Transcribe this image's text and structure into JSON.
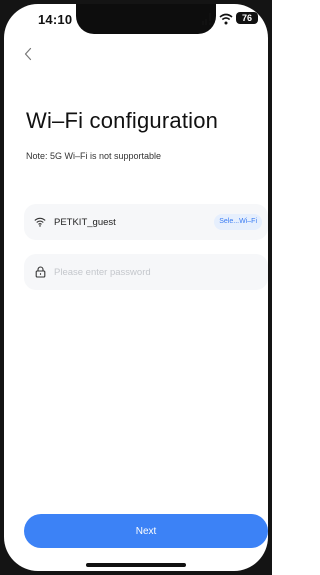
{
  "status_bar": {
    "time": "14:10",
    "battery": "76",
    "signal_icon": "signal-alert-icon",
    "wifi_icon": "wifi-icon"
  },
  "nav": {
    "back_icon": "chevron-left-icon"
  },
  "page": {
    "title": "Wi–Fi configuration",
    "note": "Note: 5G Wi–Fi is not supportable"
  },
  "wifi_field": {
    "icon": "wifi-icon",
    "ssid": "PETKIT_guest",
    "select_label": "Sele...Wi–Fi"
  },
  "password_field": {
    "icon": "lock-icon",
    "placeholder": "Please enter password",
    "value": ""
  },
  "actions": {
    "next_label": "Next"
  },
  "colors": {
    "accent": "#3c82f6",
    "field_bg": "#f6f7f9",
    "select_bg": "#e6effd",
    "select_text": "#3a7cf3"
  }
}
